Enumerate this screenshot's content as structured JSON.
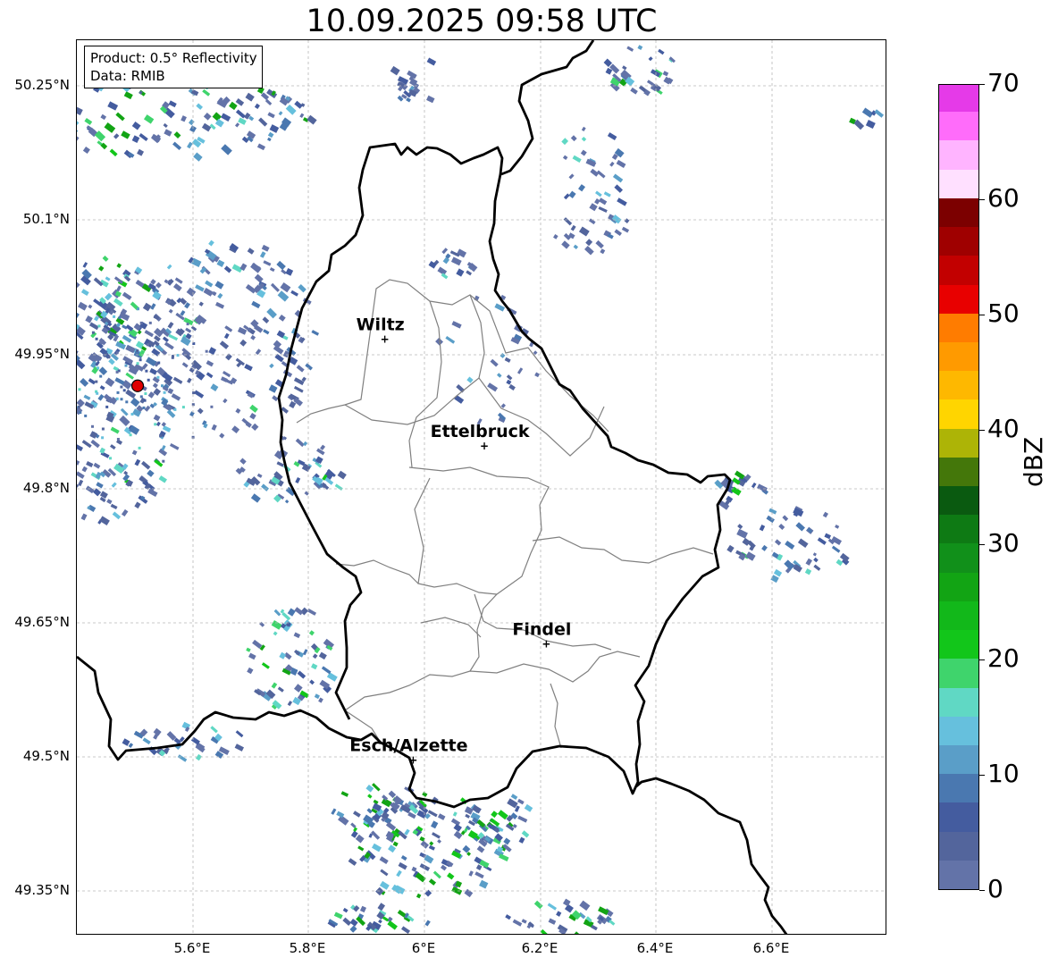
{
  "title": "10.09.2025 09:58 UTC",
  "info_box": {
    "product": "Product: 0.5° Reflectivity",
    "source": "Data: RMIB"
  },
  "map": {
    "lon_range": [
      5.4,
      6.8
    ],
    "lat_range": [
      49.3,
      50.3
    ],
    "lat_ticks": [
      "50.25°N",
      "50.1°N",
      "49.95°N",
      "49.8°N",
      "49.65°N",
      "49.5°N",
      "49.35°N"
    ],
    "lon_ticks": [
      "5.6°E",
      "5.8°E",
      "6°E",
      "6.2°E",
      "6.4°E",
      "6.6°E"
    ],
    "radar_site": {
      "lon": 5.505,
      "lat": 49.914,
      "color": "#e00000"
    },
    "cities": [
      {
        "name": "Wiltz",
        "lon": 5.932,
        "lat": 49.966
      },
      {
        "name": "Ettelbruck",
        "lon": 6.104,
        "lat": 49.847
      },
      {
        "name": "Findel",
        "lon": 6.211,
        "lat": 49.626
      },
      {
        "name": "Esch/Alzette",
        "lon": 5.981,
        "lat": 49.496
      }
    ],
    "border_color": "#000000",
    "district_color": "#808080"
  },
  "colorbar": {
    "unit": "dBZ",
    "ticks": [
      "0",
      "10",
      "20",
      "30",
      "40",
      "50",
      "60",
      "70"
    ],
    "colors": [
      "#6373a8",
      "#53659c",
      "#445c9f",
      "#4a78b0",
      "#5a9ec8",
      "#66c0dd",
      "#60d8c4",
      "#3fd46c",
      "#12c61a",
      "#12b81a",
      "#12a414",
      "#11901a",
      "#0e7a14",
      "#0a5a10",
      "#44770a",
      "#adb406",
      "#ffd500",
      "#feb800",
      "#ff9a00",
      "#ff7c00",
      "#e80000",
      "#c20000",
      "#9f0000",
      "#7c0000",
      "#ffe0ff",
      "#ffb4ff",
      "#ff6cfa",
      "#e53ae8"
    ]
  }
}
